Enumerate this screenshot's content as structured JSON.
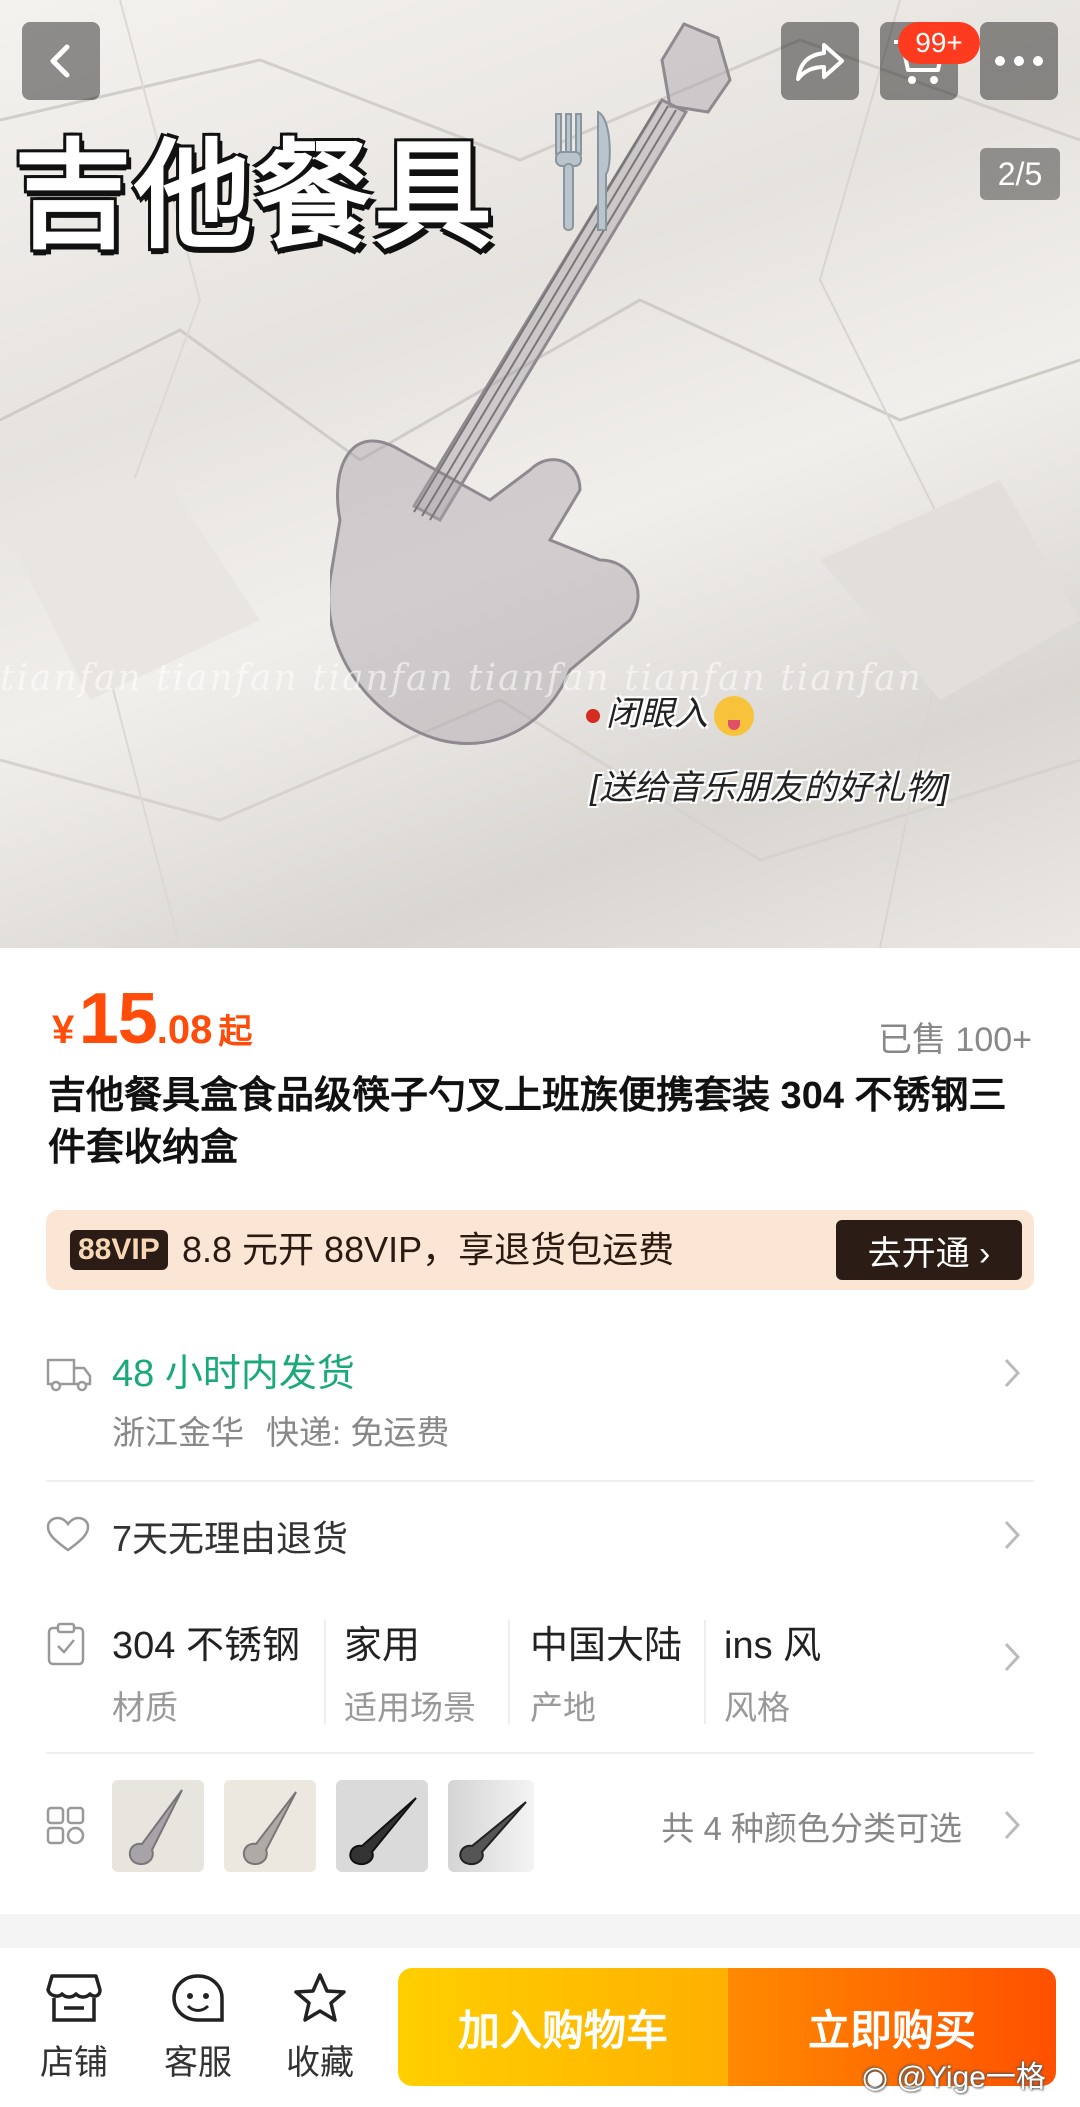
{
  "hero": {
    "title": "吉他餐具",
    "watermark": "tianfan tianfan tianfan tianfan tianfan tianfan",
    "caption_line1": "闭眼入",
    "caption_line2": "[送给音乐朋友的好礼物]",
    "page_indicator": "2/5"
  },
  "nav": {
    "cart_badge": "99+"
  },
  "price": {
    "currency": "¥",
    "integer": "15",
    "decimal": ".08",
    "suffix": "起",
    "sold": "已售 100+"
  },
  "title": "吉他餐具盒食品级筷子勺叉上班族便携套装 304 不锈钢三件套收纳盒",
  "vip": {
    "logo": "88VIP",
    "text": "8.8 元开 88VIP，享退货包运费",
    "button": "去开通 ›"
  },
  "shipping": {
    "main": "48 小时内发货",
    "origin": "浙江金华",
    "express": "快递: 免运费"
  },
  "returns": {
    "text": "7天无理由退货"
  },
  "attributes": [
    {
      "value": "304 不锈钢",
      "key": "材质"
    },
    {
      "value": "家用",
      "key": "适用场景"
    },
    {
      "value": "中国大陆",
      "key": "产地"
    },
    {
      "value": "ins 风",
      "key": "风格"
    }
  ],
  "colors": {
    "text": "共 4 种颜色分类可选"
  },
  "bottom_bar": {
    "store": "店铺",
    "service": "客服",
    "favorite": "收藏",
    "add_to_cart": "加入购物车",
    "buy_now": "立即购买"
  },
  "watermark_weibo": "@Yige一格",
  "colors_theme": {
    "accent": "#ff4c0a",
    "green": "#1aa97a",
    "vip_bg": "#fbe6d6",
    "cart_btn": "#ffb000",
    "buy_btn": "#ff5000"
  }
}
